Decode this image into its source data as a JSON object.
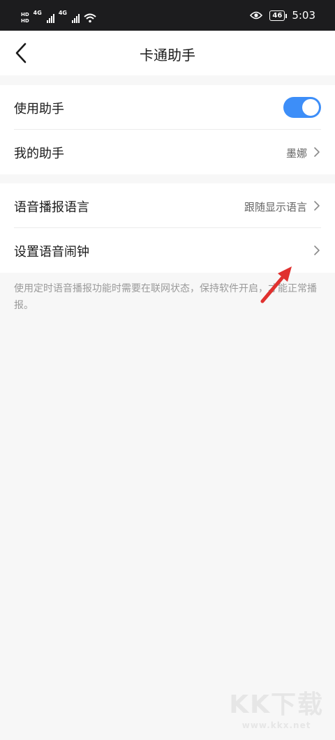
{
  "status_bar": {
    "hd1": "HD",
    "hd2": "HD",
    "net1": "4G",
    "net2": "4G",
    "battery": "46",
    "time": "5:03"
  },
  "header": {
    "title": "卡通助手",
    "back_icon": "chevron-left-icon"
  },
  "group1": {
    "use_assistant": {
      "label": "使用助手",
      "enabled": true
    },
    "my_assistant": {
      "label": "我的助手",
      "value": "墨娜"
    }
  },
  "group2": {
    "voice_language": {
      "label": "语音播报语言",
      "value": "跟随显示语言"
    },
    "voice_alarm": {
      "label": "设置语音闹钟"
    }
  },
  "note": "使用定时语音播报功能时需要在联网状态，保持软件开启，才能正常播报。",
  "colors": {
    "accent": "#3d8ef8",
    "arrow": "#e0312f",
    "background": "#f7f7f7"
  },
  "watermark": {
    "logo": "KK下载",
    "url": "www.kkx.net"
  }
}
